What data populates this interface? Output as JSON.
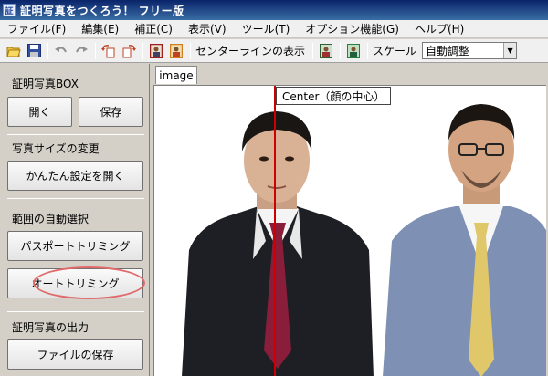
{
  "window": {
    "title": "証明写真をつくろう！ フリー版"
  },
  "menu": [
    "ファイル(F)",
    "編集(E)",
    "補正(C)",
    "表示(V)",
    "ツール(T)",
    "オプション機能(G)",
    "ヘルプ(H)"
  ],
  "toolbar": {
    "centerline_label": "センターラインの表示",
    "scale_label": "スケール",
    "scale_value": "自動調整"
  },
  "sidebar": {
    "box_label": "証明写真BOX",
    "open_button": "開く",
    "save_button": "保存",
    "size_label": "写真サイズの変更",
    "easy_settings_button": "かんたん設定を開く",
    "auto_range_label": "範囲の自動選択",
    "passport_trim_button": "パスポートトリミング",
    "auto_trim_button": "オートトリミング",
    "output_label": "証明写真の出力",
    "file_save_button": "ファイルの保存"
  },
  "content": {
    "tab_label": "image",
    "center_label": "Center（顔の中心）"
  },
  "colors": {
    "centerline": "#cc0000",
    "highlight_oval": "#e06a6a",
    "titlebar": "#0a246a"
  }
}
